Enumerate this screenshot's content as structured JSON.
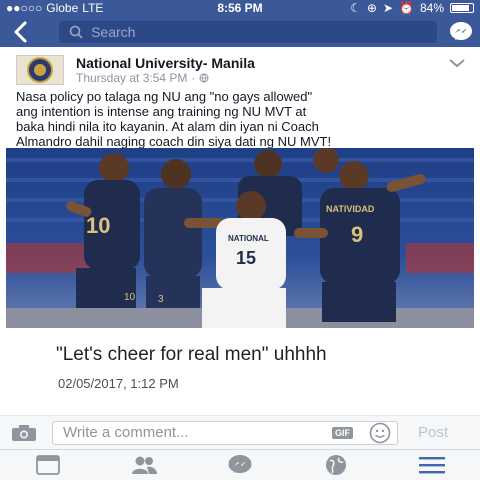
{
  "status_bar": {
    "carrier": "Globe",
    "network": "LTE",
    "time": "8:56 PM",
    "battery": "84%",
    "battery_level": 0.84
  },
  "nav": {
    "search_placeholder": "Search",
    "back_icon": "back-chevron-icon",
    "messenger_icon": "messenger-icon"
  },
  "post": {
    "page_name": "National University- Manila",
    "timestamp": "Thursday at 3:54 PM",
    "audience_icon": "globe-icon",
    "text_lines": [
      "Nasa policy po talaga ng NU ang \"no gays allowed\"",
      "ang intention is intense ang training ng NU MVT at",
      "baka hindi nila ito kayanin. At alam din iyan ni Coach",
      "Almandro dahil naging coach din siya dati ng NU MVT!"
    ],
    "photo": {
      "jersey_left": "10",
      "jersey_left_low": "10",
      "jersey_mid_low": "3",
      "jersey_center_brand": "NATIONAL",
      "jersey_center": "15",
      "jersey_right_name": "NATIVIDAD",
      "jersey_right": "9"
    }
  },
  "caption": {
    "text": "\"Let's cheer for real men\" uhhhh",
    "date": "02/05/2017, 1:12 PM"
  },
  "comment_bar": {
    "placeholder": "Write a comment...",
    "gif_label": "GIF",
    "post_label": "Post"
  },
  "tab_bar": {
    "tabs": [
      "news-feed-icon",
      "friends-icon",
      "messenger-icon",
      "globe-icon",
      "menu-icon"
    ],
    "active_color": "#4267b2",
    "inactive_color": "#90949c"
  },
  "colors": {
    "brand": "#3b5998",
    "search_bg": "#2d4886"
  }
}
